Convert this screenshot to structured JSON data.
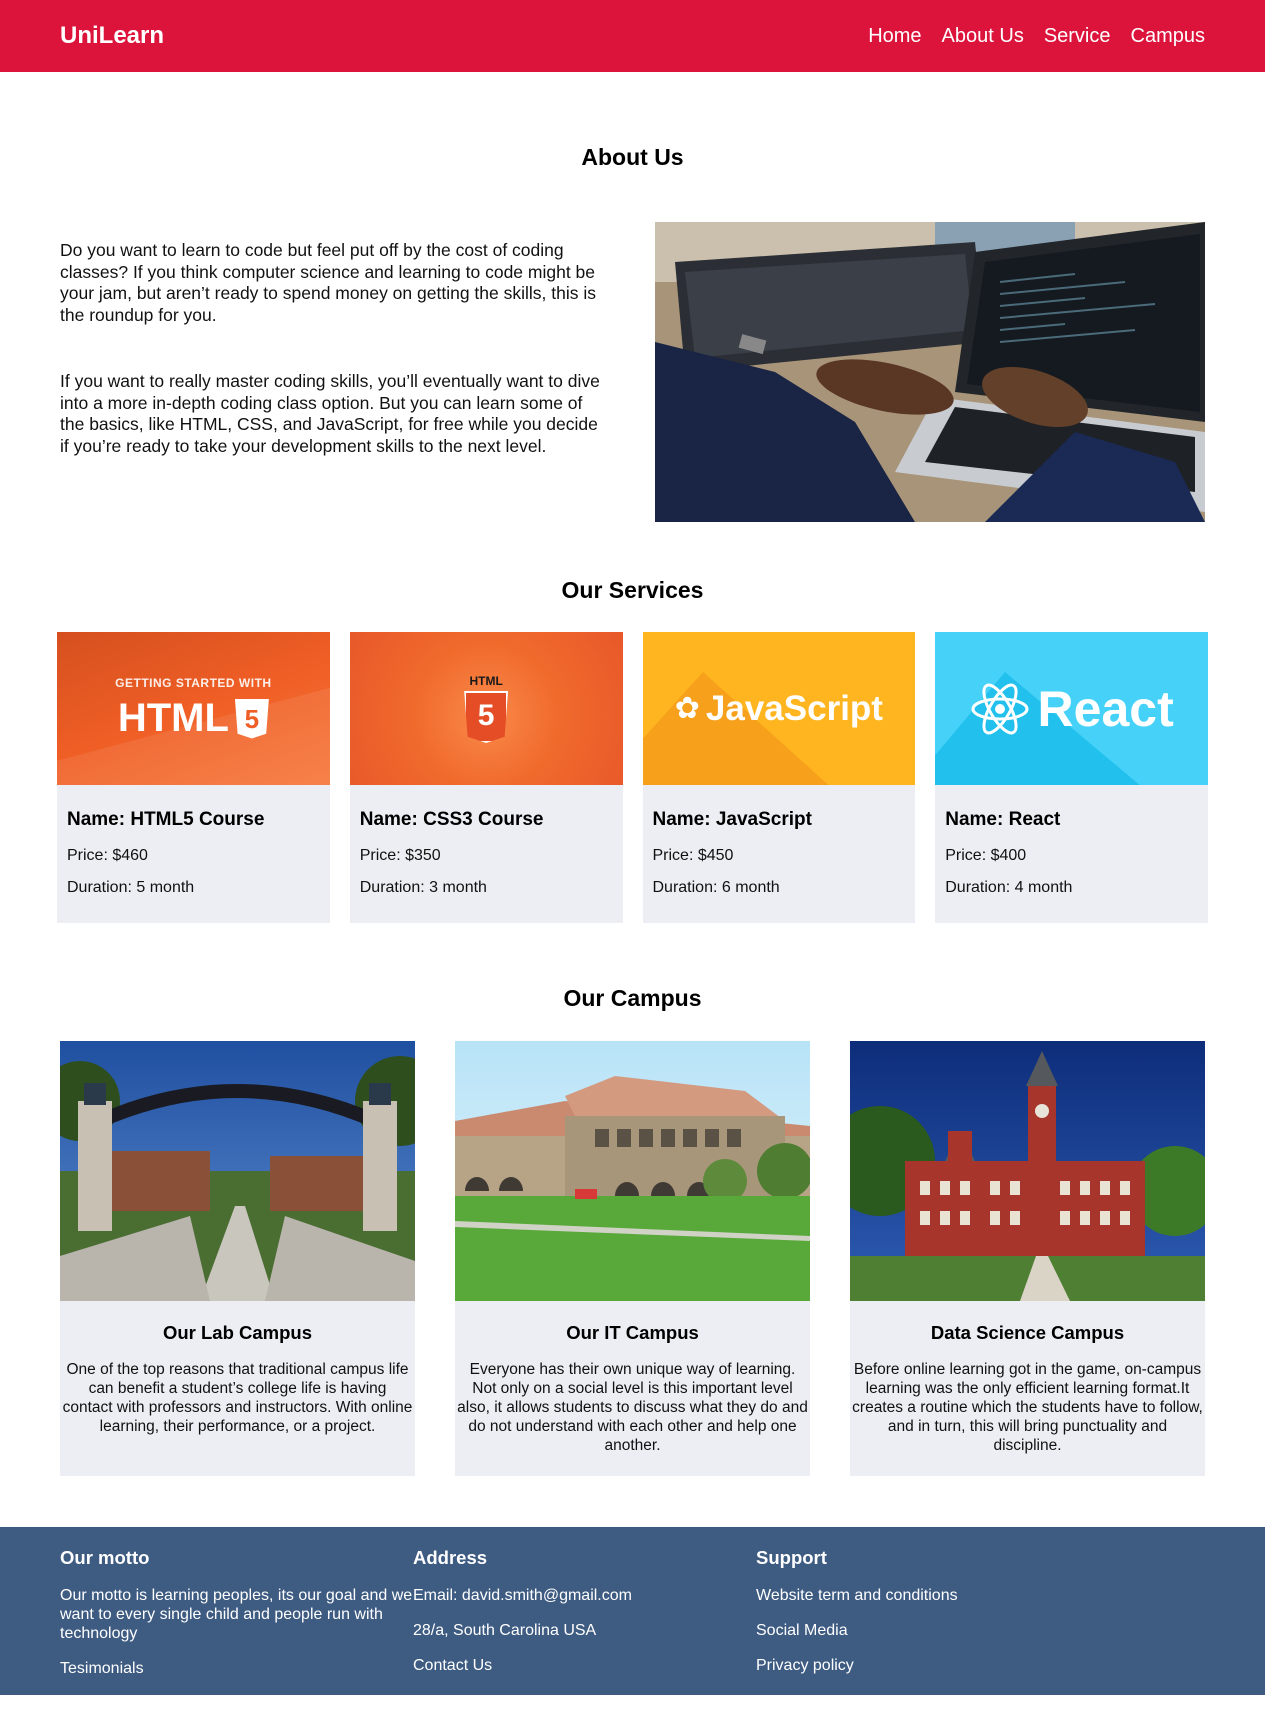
{
  "nav": {
    "brand": "UniLearn",
    "links": [
      "Home",
      "About Us",
      "Service",
      "Campus"
    ]
  },
  "about": {
    "title": "About Us",
    "paragraphs": [
      "Do you want to learn to code but feel put off by the cost of coding classes? If you think computer science and learning to code might be your jam, but aren’t ready to spend money on getting the skills, this is the roundup for you.",
      "If you want to really master coding skills, you’ll eventually want to dive into a more in-depth coding class option. But you can learn some of the basics, like HTML, CSS, and JavaScript, for free while you decide if you’re ready to take your development skills to the next level."
    ]
  },
  "services": {
    "title": "Our Services",
    "cards": [
      {
        "banner_small": "GETTING STARTED WITH",
        "banner_big": "HTML",
        "name": "Name: HTML5 Course",
        "price": "Price: $460",
        "duration": "Duration: 5 month"
      },
      {
        "banner_small": "HTML",
        "banner_big": "5",
        "name": "Name: CSS3 Course",
        "price": "Price: $350",
        "duration": "Duration: 3 month"
      },
      {
        "banner_big": "JavaScript",
        "name": "Name: JavaScript",
        "price": "Price: $450",
        "duration": "Duration: 6 month"
      },
      {
        "banner_big": "React",
        "name": "Name: React",
        "price": "Price: $400",
        "duration": "Duration: 4 month"
      }
    ],
    "colors": {
      "html": "#f0642a",
      "html5": "#f0642a",
      "js": "#ffb51f",
      "react": "#3fcdf5"
    }
  },
  "campus": {
    "title": "Our Campus",
    "cards": [
      {
        "name": "Our Lab Campus",
        "text": "One of the top reasons that traditional campus life can benefit a student’s college life is having contact with professors and instructors. With online learning, their performance, or a project."
      },
      {
        "name": "Our IT Campus",
        "text": "Everyone has their own unique way of learning. Not only on a social level is this important level also, it allows students to discuss what they do and do not understand with each other and help one another."
      },
      {
        "name": "Data Science Campus",
        "text": "Before online learning got in the game, on-campus learning was the only efficient learning format.It creates a routine which the students have to follow, and in turn, this will bring punctuality and discipline."
      }
    ]
  },
  "footer": {
    "motto_title": "Our motto",
    "motto_text": "Our motto is learning peoples, its our goal and we want to every single child and people run with technology",
    "testimonials": "Tesimonials",
    "address_title": "Address",
    "email": "Email: david.smith@gmail.com",
    "address": "28/a, South Carolina USA",
    "contact": "Contact Us",
    "support_title": "Support",
    "terms": "Website term and conditions",
    "social": "Social Media",
    "privacy": "Privacy policy"
  },
  "theme": {
    "nav_bg": "#dc143c",
    "footer_bg": "#3e5b82",
    "card_bg": "#edeef3"
  }
}
